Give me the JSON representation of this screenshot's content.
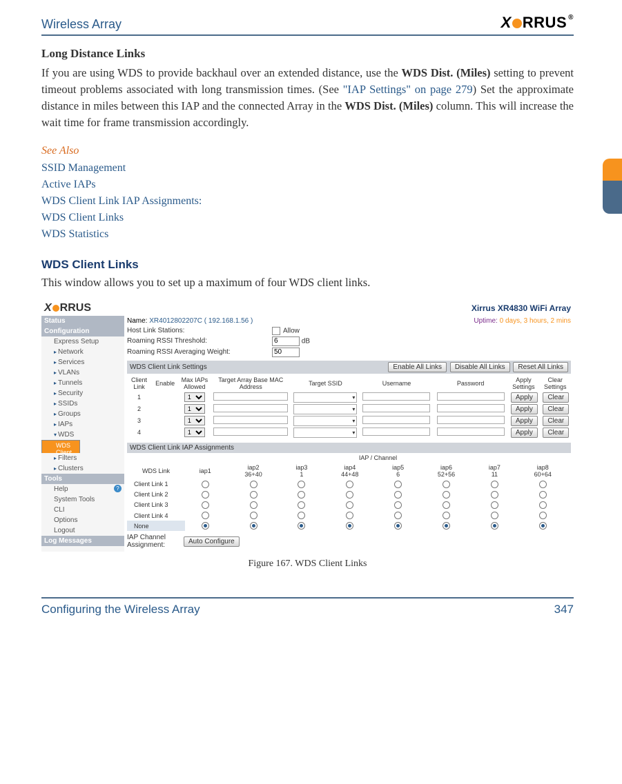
{
  "header": {
    "doc_title": "Wireless Array",
    "logo_text": "XIRRUS"
  },
  "section1": {
    "title": "Long Distance Links",
    "para_a": "If you are using WDS to provide backhaul over an extended distance, use the ",
    "bold_a": "WDS Dist. (Miles)",
    "para_b": " setting to prevent timeout problems associated with long transmission times. (See ",
    "link": "\"IAP Settings\" on page 279",
    "para_c": ") Set the approximate distance in miles between this IAP and the connected Array in the ",
    "bold_b": "WDS Dist. (Miles)",
    "para_d": " column. This will increase the wait time for frame transmission accordingly."
  },
  "see_also": {
    "label": "See Also",
    "items": [
      "SSID Management",
      "Active IAPs",
      "WDS Client Link IAP Assignments:",
      "WDS Client Links",
      "WDS Statistics"
    ]
  },
  "section2": {
    "title": "WDS Client Links",
    "intro": "This window allows you to set up a maximum of four WDS client links."
  },
  "screenshot": {
    "logo": "XIRRUS",
    "product": "Xirrus XR4830 WiFi Array",
    "name_label": "Name:",
    "name_value": "XR4012802207C   ( 192.168.1.56 )",
    "uptime_label": "Uptime:",
    "uptime_value": "0 days, 3 hours, 2 mins",
    "rows": {
      "host": {
        "label": "Host Link Stations:",
        "opt": "Allow"
      },
      "rssi": {
        "label": "Roaming RSSI Threshold:",
        "value": "6",
        "unit": "dB"
      },
      "weight": {
        "label": "Roaming RSSI Averaging Weight:",
        "value": "50"
      }
    },
    "sidebar": {
      "status": "Status",
      "configuration": "Configuration",
      "items": [
        "Express Setup",
        "Network",
        "Services",
        "VLANs",
        "Tunnels",
        "Security",
        "SSIDs",
        "Groups",
        "IAPs",
        "WDS"
      ],
      "selected": "WDS Client Links",
      "filters": "Filters",
      "clusters": "Clusters",
      "tools": "Tools",
      "tools_items": [
        "Help",
        "System Tools",
        "CLI",
        "Options",
        "Logout"
      ],
      "log": "Log Messages"
    },
    "settings": {
      "bar": "WDS Client Link Settings",
      "buttons": [
        "Enable All Links",
        "Disable All Links",
        "Reset All Links"
      ],
      "cols": [
        "Client Link",
        "Enable",
        "Max IAPs Allowed",
        "Target Array Base MAC Address",
        "Target SSID",
        "Username",
        "Password",
        "Apply Settings",
        "Clear Settings"
      ],
      "rows": [
        "1",
        "2",
        "3",
        "4"
      ],
      "max_iaps": "1",
      "apply": "Apply",
      "clear": "Clear"
    },
    "iap": {
      "bar": "WDS Client Link IAP Assignments",
      "super": "IAP / Channel",
      "wds_link": "WDS Link",
      "cols": [
        {
          "n": "iap1",
          "sub": ""
        },
        {
          "n": "iap2",
          "sub": "36+40"
        },
        {
          "n": "iap3",
          "sub": "1"
        },
        {
          "n": "iap4",
          "sub": "44+48"
        },
        {
          "n": "iap5",
          "sub": "6"
        },
        {
          "n": "iap6",
          "sub": "52+56"
        },
        {
          "n": "iap7",
          "sub": "11"
        },
        {
          "n": "iap8",
          "sub": "60+64"
        }
      ],
      "rows": [
        "Client Link 1",
        "Client Link 2",
        "Client Link 3",
        "Client Link 4",
        "None"
      ],
      "auto_label": "IAP Channel Assignment:",
      "auto_btn": "Auto Configure"
    }
  },
  "figure_caption": "Figure 167. WDS Client Links",
  "footer": {
    "left": "Configuring the Wireless Array",
    "right": "347"
  }
}
